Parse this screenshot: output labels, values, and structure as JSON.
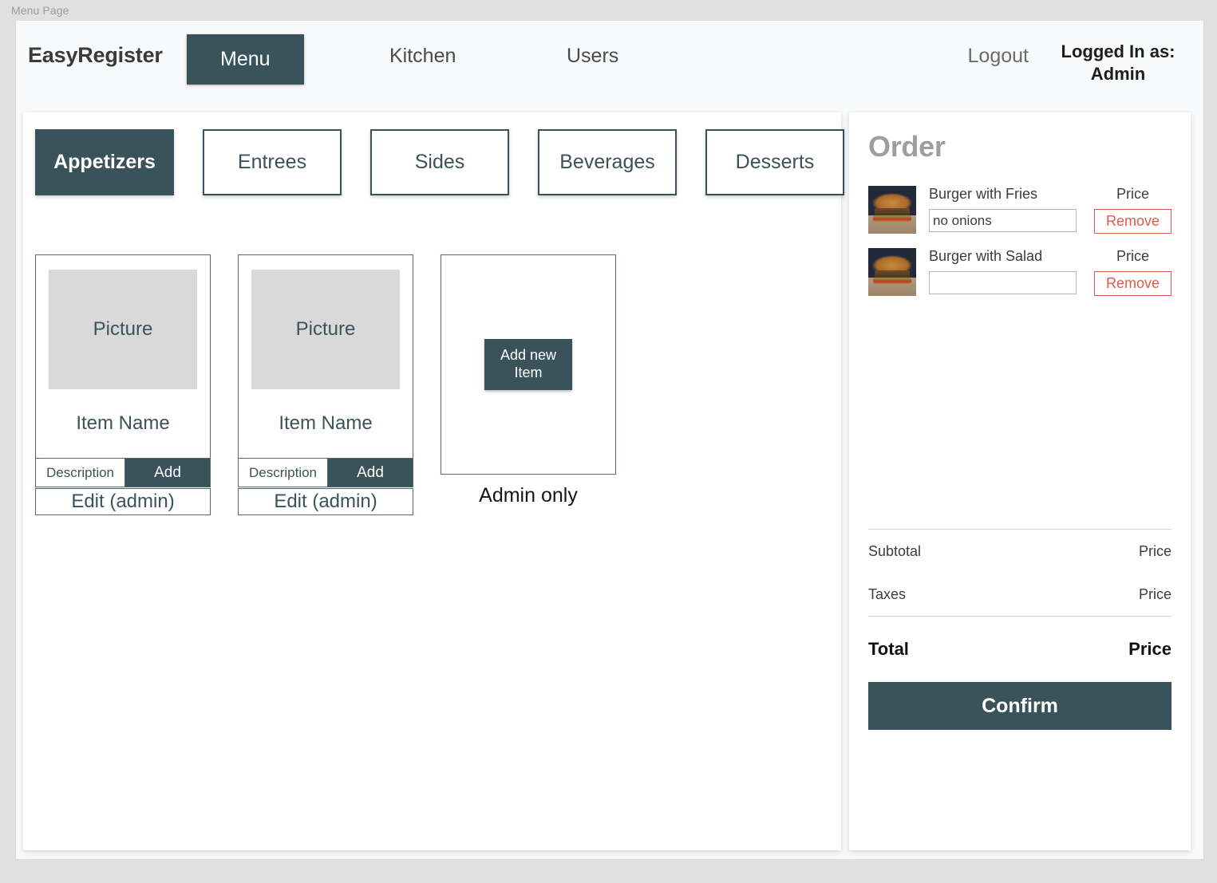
{
  "window": {
    "label": "Menu Page"
  },
  "navbar": {
    "brand": "EasyRegister",
    "items": [
      {
        "label": "Menu",
        "active": true
      },
      {
        "label": "Kitchen",
        "active": false
      },
      {
        "label": "Users",
        "active": false
      }
    ],
    "logout": "Logout",
    "logged_in_as": "Logged In as:\nAdmin"
  },
  "categories": [
    {
      "label": "Appetizers",
      "active": true
    },
    {
      "label": "Entrees",
      "active": false
    },
    {
      "label": "Sides",
      "active": false
    },
    {
      "label": "Beverages",
      "active": false
    },
    {
      "label": "Desserts",
      "active": false
    }
  ],
  "menu_items": [
    {
      "picture_placeholder": "Picture",
      "name": "Item Name",
      "description_label": "Description",
      "add_label": "Add",
      "edit_label": "Edit (admin)"
    },
    {
      "picture_placeholder": "Picture",
      "name": "Item Name",
      "description_label": "Description",
      "add_label": "Add",
      "edit_label": "Edit (admin)"
    }
  ],
  "add_new_card": {
    "button_label": "Add new Item",
    "caption": "Admin only"
  },
  "order": {
    "title": "Order",
    "items": [
      {
        "name": "Burger with Fries",
        "note_value": "no onions",
        "price_label": "Price",
        "remove_label": "Remove",
        "thumbnail": "burger-photo"
      },
      {
        "name": "Burger with Salad",
        "note_value": "",
        "price_label": "Price",
        "remove_label": "Remove",
        "thumbnail": "burger-photo"
      }
    ],
    "subtotal_label": "Subtotal",
    "subtotal_value": "Price",
    "taxes_label": "Taxes",
    "taxes_value": "Price",
    "total_label": "Total",
    "total_value": "Price",
    "confirm_label": "Confirm"
  },
  "colors": {
    "accent": "#3a535b",
    "danger": "#e05a4a",
    "panel": "#ffffff",
    "page_background": "#f7f9fa",
    "placeholder_grey": "#d9d9d9"
  }
}
